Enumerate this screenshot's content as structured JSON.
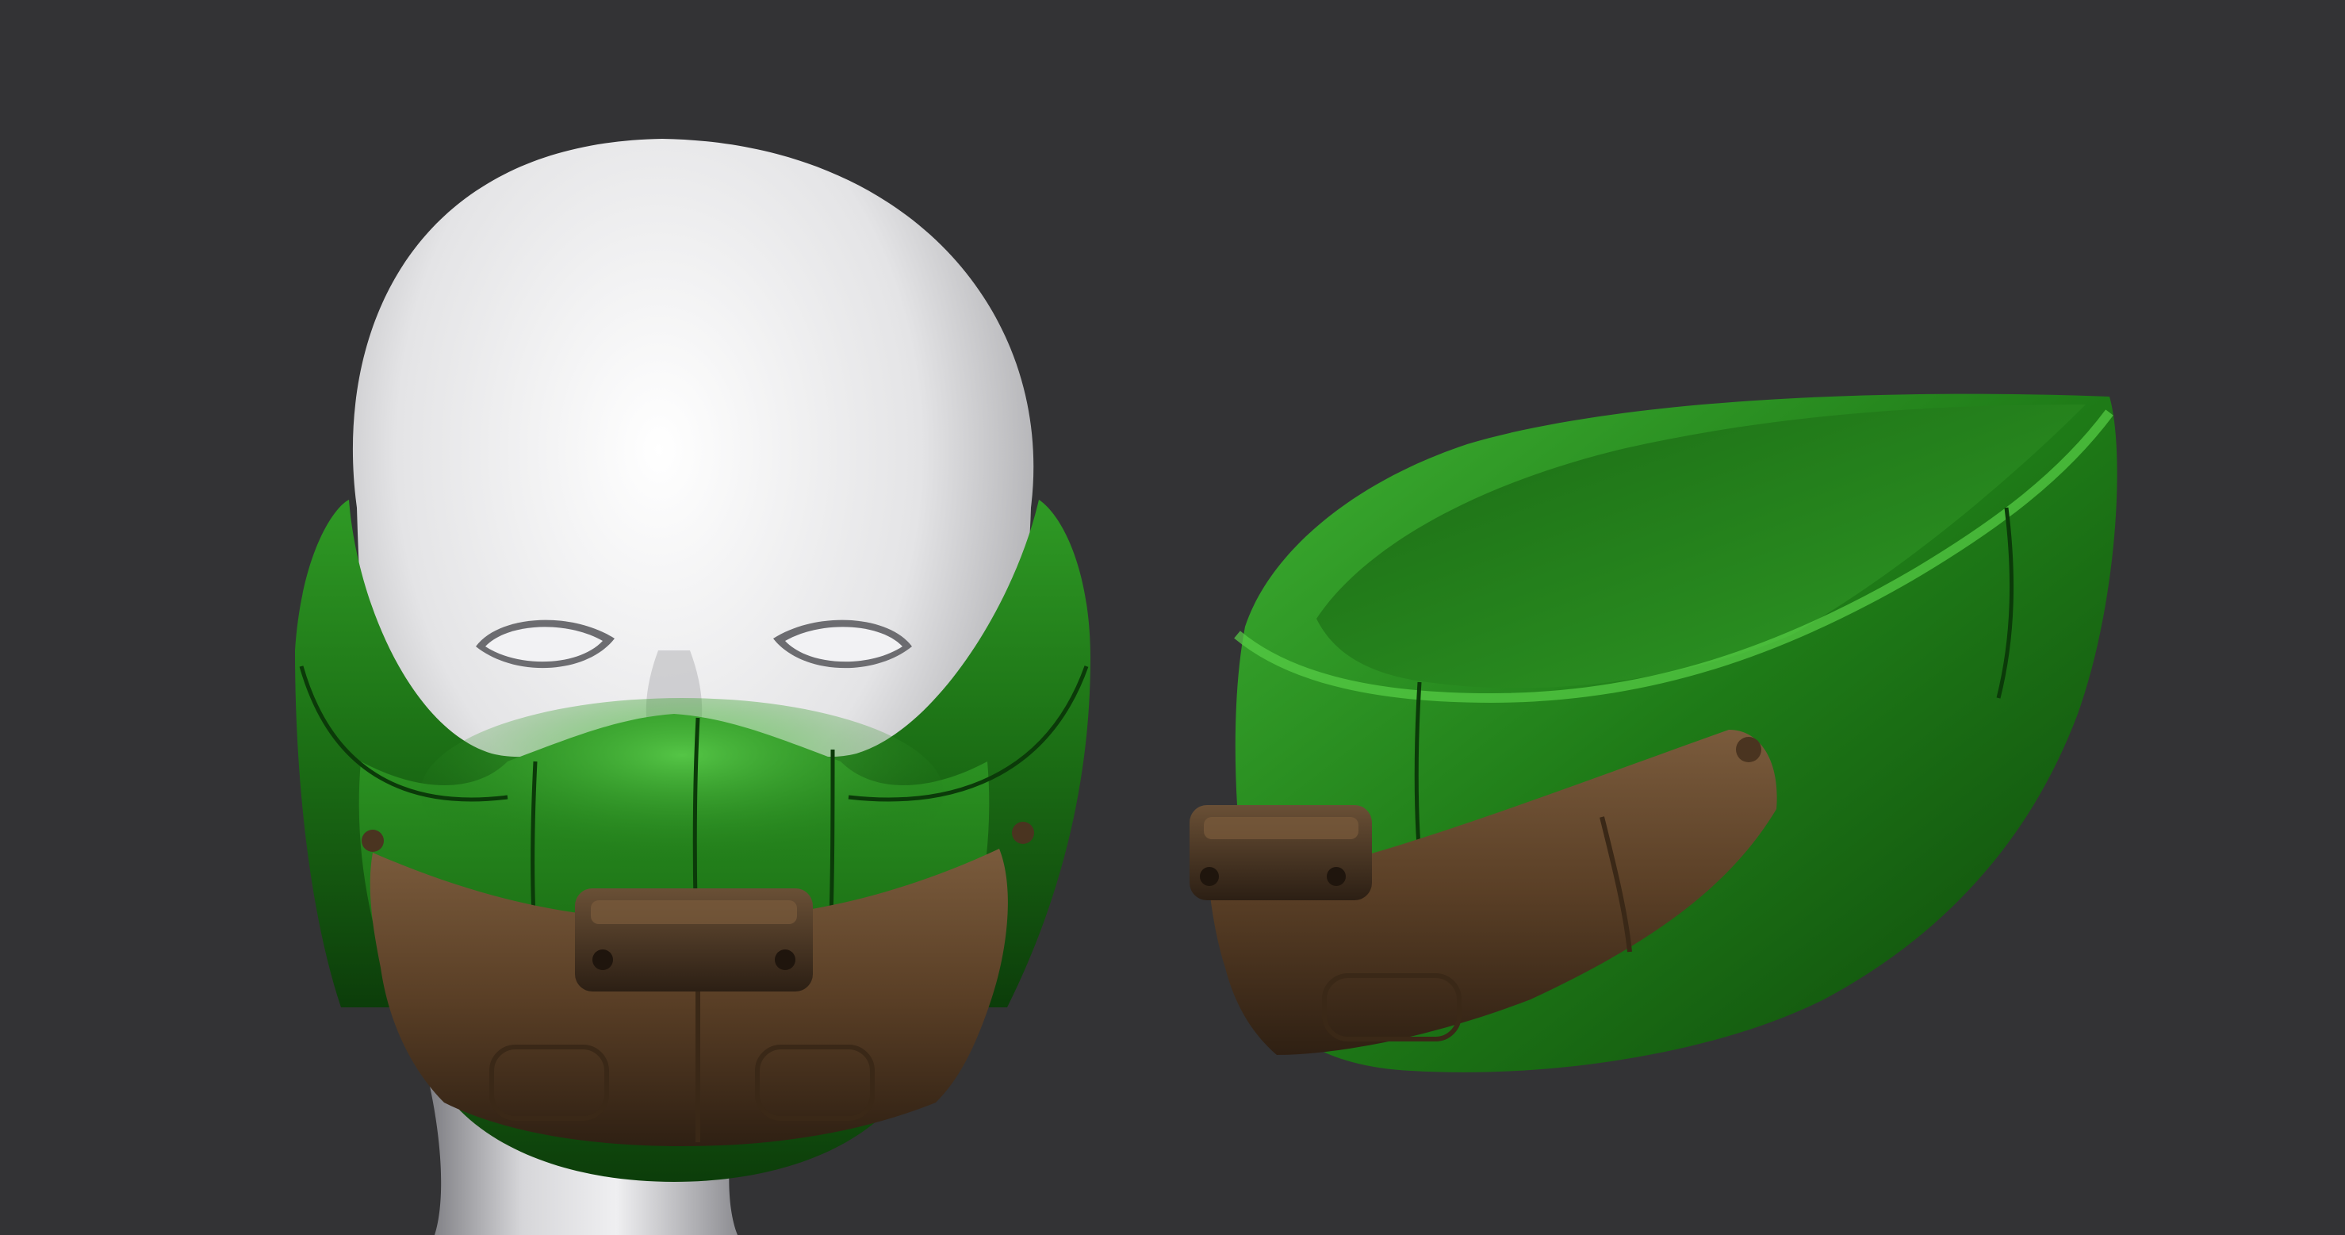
{
  "scene": {
    "background": "#333335",
    "colors": {
      "head_light": "#ffffff",
      "head_mid": "#dcdcde",
      "head_dark": "#8e8e92",
      "mask_light": "#47c23a",
      "mask_mid": "#1f7a18",
      "mask_dark": "#0c3d0a",
      "strap_light": "#8a6a48",
      "strap_mid": "#5a3f26",
      "strap_dark": "#2f2013",
      "buckle_dark": "#3a2a1c"
    }
  }
}
